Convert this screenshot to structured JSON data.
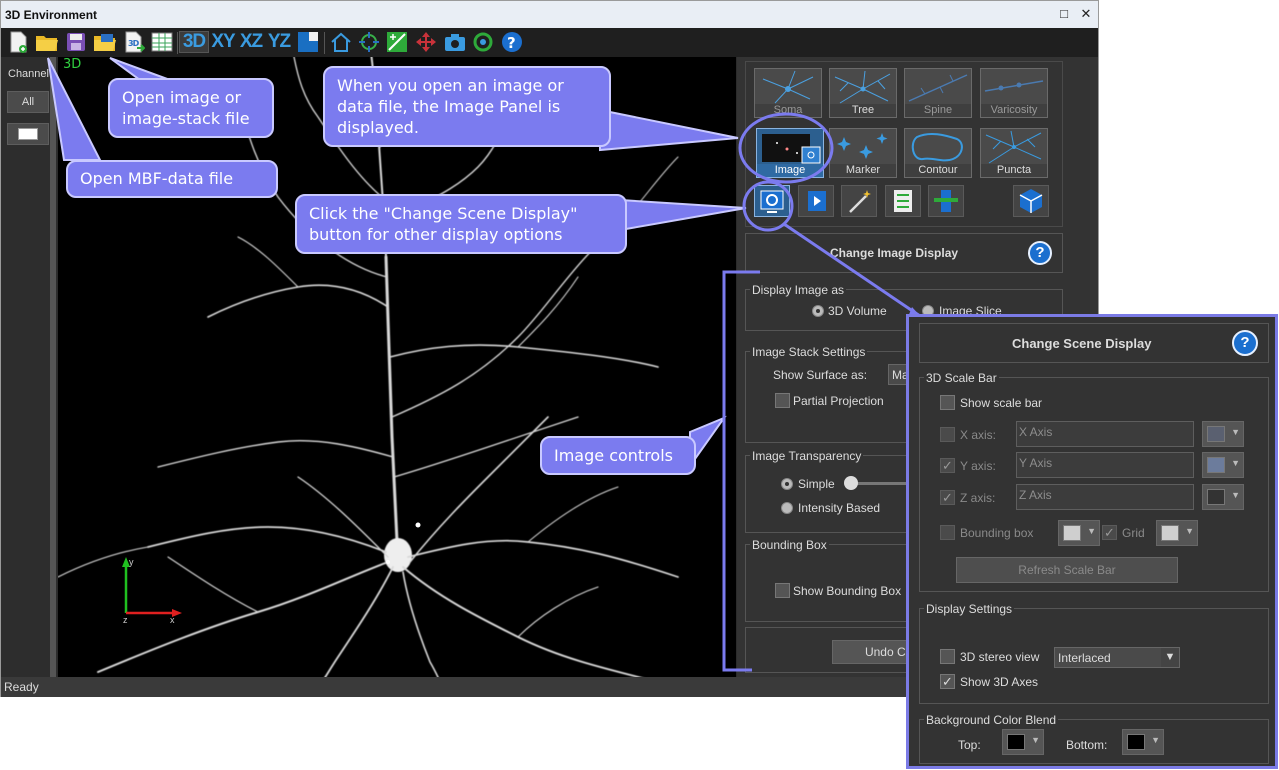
{
  "window": {
    "title": "3D Environment",
    "min_btn": "□",
    "close_btn": "✕"
  },
  "toolbar": {
    "xy": "XY",
    "xz": "XZ",
    "yz": "YZ",
    "view3d": "3D"
  },
  "channel": {
    "label": "Channel",
    "all_button": "All"
  },
  "viewport": {
    "label": "3D",
    "axes": {
      "x": "x",
      "y": "y",
      "z": "z"
    }
  },
  "status": "Ready",
  "tools": {
    "tiles": [
      {
        "label": "Soma"
      },
      {
        "label": "Tree"
      },
      {
        "label": "Spine"
      },
      {
        "label": "Varicosity"
      },
      {
        "label": "Image"
      },
      {
        "label": "Marker"
      },
      {
        "label": "Contour"
      },
      {
        "label": "Puncta"
      }
    ]
  },
  "image_panel": {
    "title": "Change Image Display",
    "display_as": {
      "title": "Display Image as",
      "opt_volume": "3D Volume",
      "opt_slice": "Image Slice"
    },
    "stack": {
      "title": "Image Stack Settings",
      "surface_label": "Show Surface as:",
      "surface_value": "Ma",
      "partial": "Partial Projection"
    },
    "transparency": {
      "title": "Image Transparency",
      "simple": "Simple",
      "intensity": "Intensity Based"
    },
    "bbox": {
      "title": "Bounding Box",
      "show": "Show Bounding Box"
    },
    "undo": "Undo Cha"
  },
  "scene_panel": {
    "title": "Change Scene Display",
    "scale_bar": {
      "title": "3D Scale Bar",
      "show": "Show scale bar",
      "x_label": "X axis:",
      "x_value": "X Axis",
      "y_label": "Y axis:",
      "y_value": "Y Axis",
      "z_label": "Z axis:",
      "z_value": "Z Axis",
      "bbox": "Bounding box",
      "grid": "Grid",
      "refresh": "Refresh Scale Bar"
    },
    "display": {
      "title": "Display Settings",
      "stereo": "3D stereo view",
      "stereo_mode": "Interlaced",
      "show_axes": "Show 3D Axes"
    },
    "bg": {
      "title": "Background Color Blend",
      "top": "Top:",
      "bottom": "Bottom:"
    }
  },
  "callouts": {
    "open_image": "Open image or image-stack file",
    "open_mbf": "Open MBF-data file",
    "image_panel": "When you open an image or data file, the Image Panel is displayed.",
    "scene": "Click the \"Change Scene Display\" button for other display options",
    "image_controls": "Image controls"
  }
}
